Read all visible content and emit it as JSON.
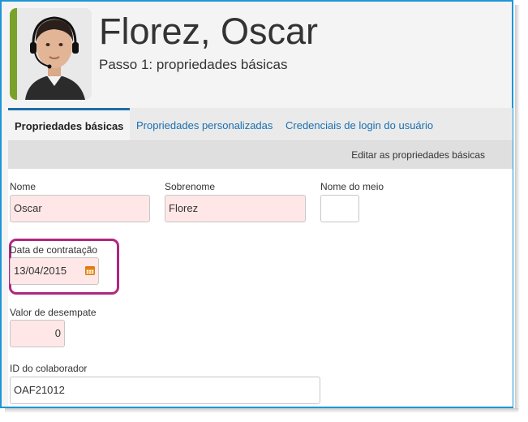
{
  "header": {
    "title": "Florez, Oscar",
    "subtitle": "Passo 1: propriedades básicas"
  },
  "tabs": [
    {
      "label": "Propriedades básicas",
      "active": true
    },
    {
      "label": "Propriedades personalizadas",
      "active": false
    },
    {
      "label": "Credenciais de login do usuário",
      "active": false
    }
  ],
  "actionbar": {
    "edit_label": "Editar as propriedades básicas"
  },
  "fields": {
    "first_name": {
      "label": "Nome",
      "value": "Oscar"
    },
    "last_name": {
      "label": "Sobrenome",
      "value": "Florez"
    },
    "middle_name": {
      "label": "Nome do meio",
      "value": ""
    },
    "hire_date": {
      "label": "Data de contratação",
      "value": "13/04/2015"
    },
    "tiebreaker": {
      "label": "Valor de desempate",
      "value": "0"
    },
    "employee_id": {
      "label": "ID do colaborador",
      "value": "OAF21012"
    }
  },
  "colors": {
    "accent": "#1e6ea6",
    "required_field": "#ffe7e7",
    "highlight": "#b2267f",
    "avatar_bar": "#7aa22a"
  }
}
